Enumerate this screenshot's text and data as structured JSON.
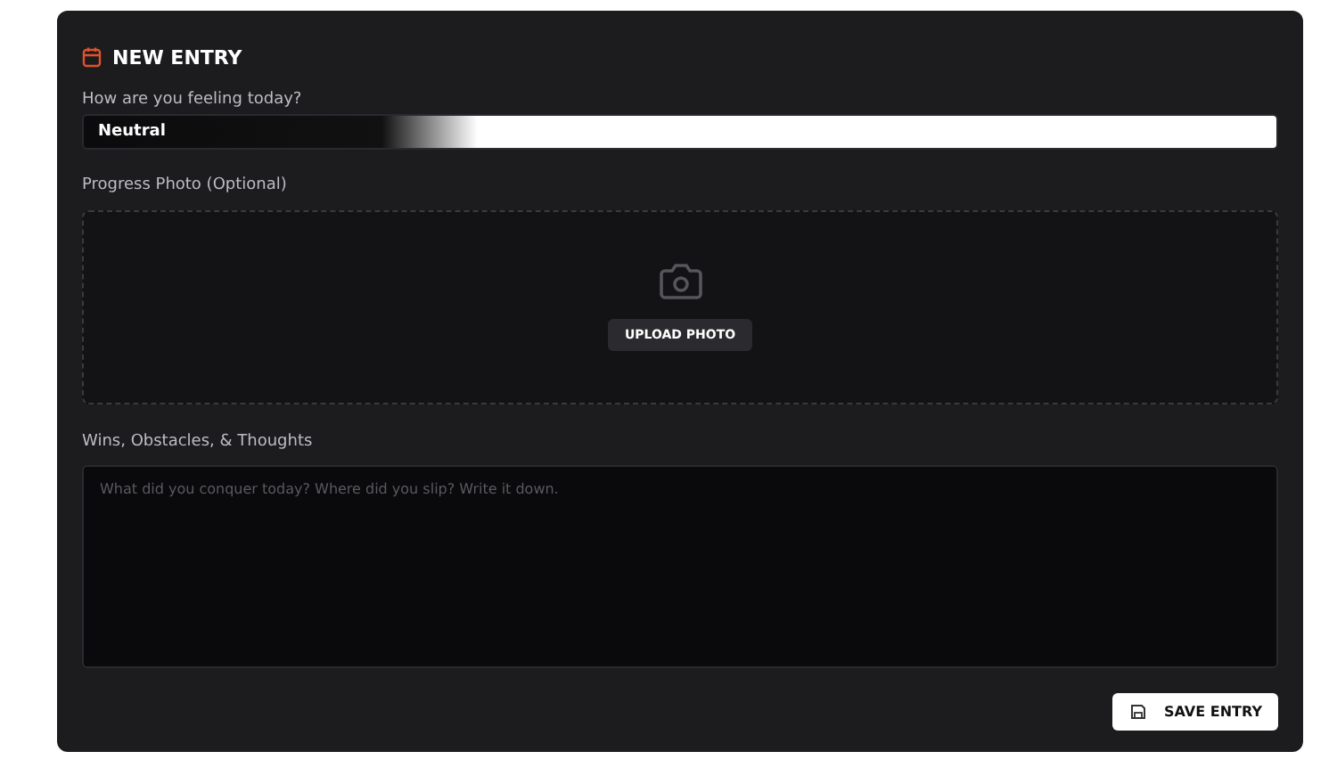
{
  "card": {
    "title": "NEW ENTRY"
  },
  "mood": {
    "label": "How are you feeling today?",
    "value": "Neutral"
  },
  "photo": {
    "label": "Progress Photo (Optional)",
    "button": "UPLOAD PHOTO"
  },
  "notes": {
    "label": "Wins, Obstacles, & Thoughts",
    "placeholder": "What did you conquer today? Where did you slip? Write it down."
  },
  "save_button": "SAVE ENTRY"
}
